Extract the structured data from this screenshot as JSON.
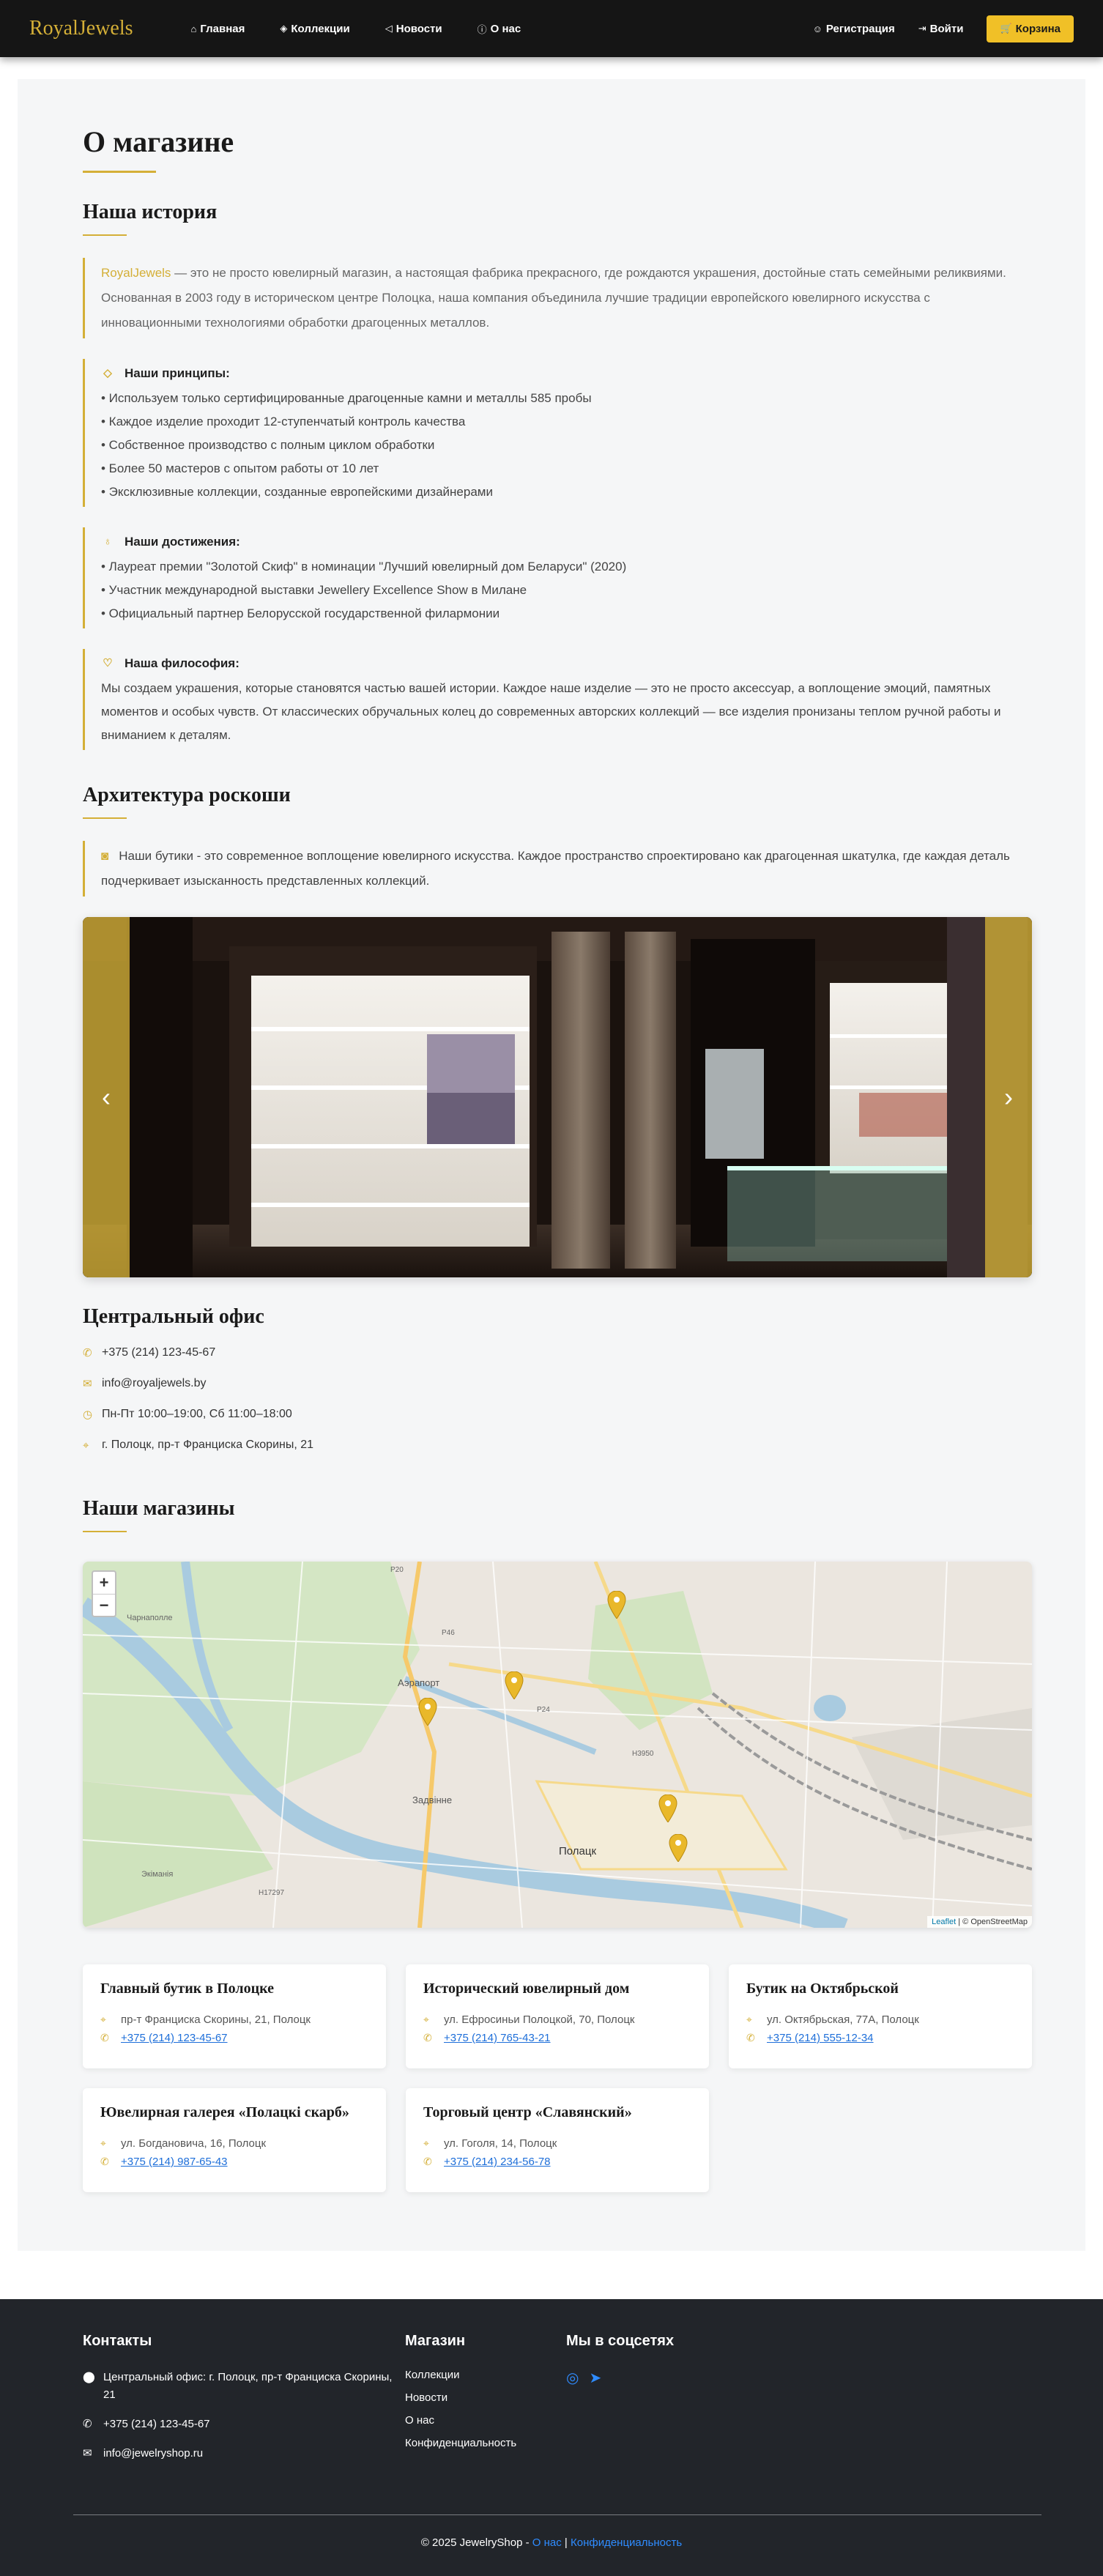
{
  "nav": {
    "brand": "RoyalJewels",
    "links": [
      {
        "icon": "home-icon",
        "label": "Главная"
      },
      {
        "icon": "gem-icon",
        "label": "Коллекции"
      },
      {
        "icon": "megaphone-icon",
        "label": "Новости"
      },
      {
        "icon": "info-icon",
        "label": "О нас"
      }
    ],
    "register": "Регистрация",
    "login": "Войти",
    "cart": "Корзина"
  },
  "page": {
    "title": "О магазине",
    "history_title": "Наша история",
    "intro_brand": "RoyalJewels",
    "intro_text": " — это не просто ювелирный магазин, а настоящая фабрика прекрасного, где рождаются украшения, достойные стать семейными реликвиями. Основанная в 2003 году в историческом центре Полоцка, наша компания объединила лучшие традиции европейского ювелирного искусства с инновационными технологиями обработки драгоценных металлов.",
    "principles_title": "Наши принципы:",
    "principles": [
      "• Используем только сертифицированные драгоценные камни и металлы 585 пробы",
      "• Каждое изделие проходит 12-ступенчатый контроль качества",
      "• Собственное производство с полным циклом обработки",
      "• Более 50 мастеров с опытом работы от 10 лет",
      "• Эксклюзивные коллекции, созданные европейскими дизайнерами"
    ],
    "achievements_title": "Наши достижения:",
    "achievements": [
      "• Лауреат премии \"Золотой Скиф\" в номинации \"Лучший ювелирный дом Беларуси\" (2020)",
      "• Участник международной выставки Jewellery Excellence Show в Милане",
      "• Официальный партнер Белорусской государственной филармонии"
    ],
    "philosophy_title": "Наша философия:",
    "philosophy_text": "Мы создаем украшения, которые становятся частью вашей истории. Каждое наше изделие — это не просто аксессуар, а воплощение эмоций, памятных моментов и особых чувств. От классических обручальных колец до современных авторских коллекций — все изделия пронизаны теплом ручной работы и вниманием к деталям.",
    "arch_title": "Архитектура роскоши",
    "arch_text": "Наши бутики - это современное воплощение ювелирного искусства. Каждое пространство спроектировано как драгоценная шкатулка, где каждая деталь подчеркивает изысканность представленных коллекций.",
    "office_title": "Центральный офис",
    "office": [
      {
        "icon": "phone-icon",
        "text": "+375 (214) 123-45-67"
      },
      {
        "icon": "envelope-icon",
        "text": "info@royaljewels.by"
      },
      {
        "icon": "clock-icon",
        "text": "Пн-Пт 10:00–19:00, Сб 11:00–18:00"
      },
      {
        "icon": "map-pin-icon",
        "text": "г. Полоцк, пр-т Франциска Скорины, 21"
      }
    ],
    "stores_title": "Наши магазины"
  },
  "map": {
    "zoom_in": "+",
    "zoom_out": "−",
    "attrib_leaflet": "Leaflet",
    "attrib_rest": " | © OpenStreetMap",
    "labels": [
      "Полацк",
      "Задвінне",
      "Аэрапорт",
      "Экіманія",
      "Р20",
      "Р46",
      "Р24",
      "Н3950",
      "Н17297"
    ]
  },
  "stores": [
    {
      "name": "Главный бутик в Полоцке",
      "address": "пр-т Франциска Скорины, 21, Полоцк",
      "phone": "+375 (214) 123-45-67"
    },
    {
      "name": "Исторический ювелирный дом",
      "address": "ул. Ефросиньи Полоцкой, 70, Полоцк",
      "phone": "+375 (214) 765-43-21"
    },
    {
      "name": "Бутик на Октябрьской",
      "address": "ул. Октябрьская, 77А, Полоцк",
      "phone": "+375 (214) 555-12-34"
    },
    {
      "name": "Ювелирная галерея «Полацкі скарб»",
      "address": "ул. Богдановича, 16, Полоцк",
      "phone": "+375 (214) 987-65-43"
    },
    {
      "name": "Торговый центр «Славянский»",
      "address": "ул. Гоголя, 14, Полоцк",
      "phone": "+375 (214) 234-56-78"
    }
  ],
  "footer": {
    "contacts_title": "Контакты",
    "office": "Центральный офис: г. Полоцк, пр-т Франциска Скорины, 21",
    "phone": "+375 (214) 123-45-67",
    "email": "info@jewelryshop.ru",
    "shop_title": "Магазин",
    "shop_links": [
      "Коллекции",
      "Новости",
      "О нас",
      "Конфиденциальность"
    ],
    "social_title": "Мы в соцсетях",
    "copyright": "© 2025 JewelryShop - ",
    "about_link": "О нас",
    "privacy_link": "Конфиденциальность"
  },
  "colors": {
    "gold": "#d4af37",
    "cart": "#f0c027",
    "nav_bg": "#151515",
    "footer_bg": "#22252a",
    "link": "#1e6fd9"
  }
}
